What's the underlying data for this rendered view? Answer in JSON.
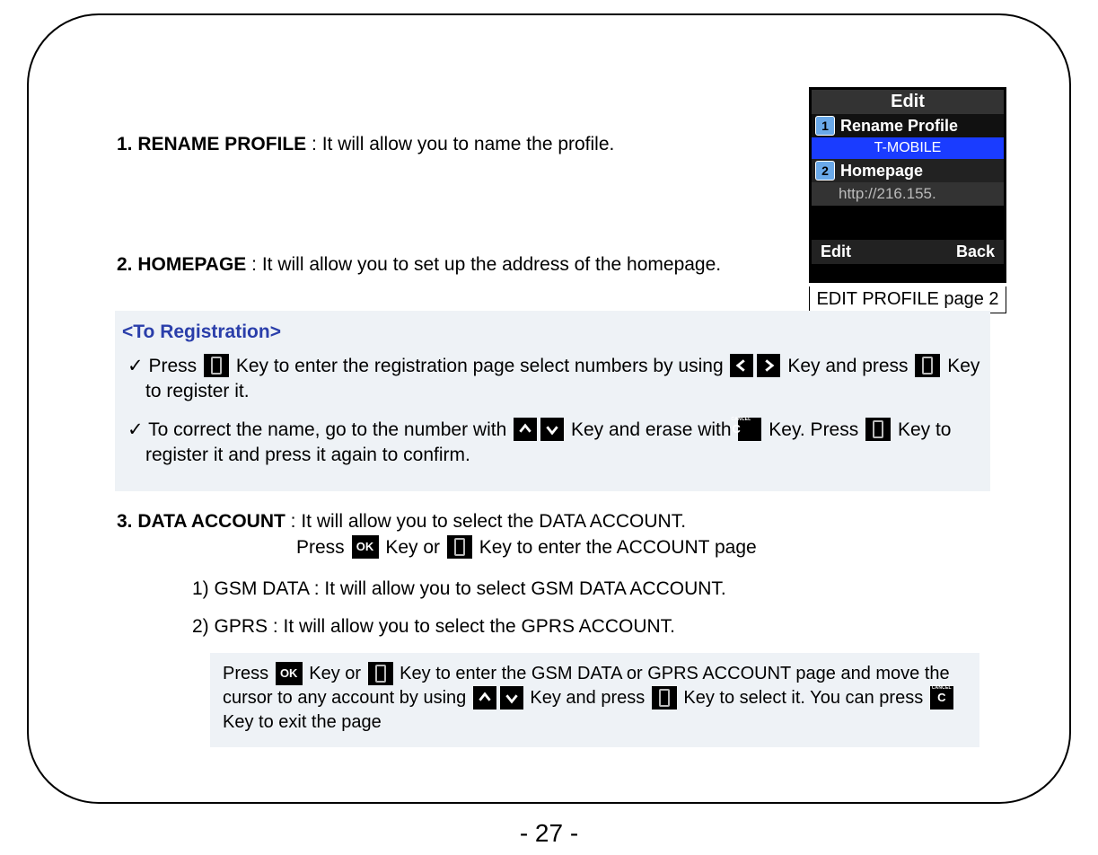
{
  "page_number": "- 27 -",
  "figure": {
    "title": "Edit",
    "item1_num": "1",
    "item1_label": "Rename Profile",
    "selected_value": "T-MOBILE",
    "item2_num": "2",
    "item2_label": "Homepage",
    "url_value": "http://216.155.",
    "softkey_left": "Edit",
    "softkey_right": "Back",
    "caption": "EDIT PROFILE page 2"
  },
  "sections": {
    "s1_heading": "1. RENAME PROFILE",
    "s1_text": " : It will allow you to name the profile.",
    "s2_heading": "2. HOMEPAGE",
    "s2_text": " : It will allow you to set up the address of the homepage.",
    "reg_title": "<To Registration>",
    "reg1_a": "Press",
    "reg1_b": "Key to enter the registration page  select numbers by using",
    "reg1_c": "Key and press",
    "reg1_d": "Key to register it.",
    "reg2_a": "To correct the name, go to the number with",
    "reg2_b": " Key and erase with",
    "reg2_c": "Key. Press",
    "reg2_d": "Key to register it and press it again to confirm.",
    "s3_heading": "3. DATA ACCOUNT",
    "s3_text": " : It will allow you to select the DATA ACCOUNT.",
    "s3_sub_a": "Press ",
    "s3_sub_b": "Key or ",
    "s3_sub_c": " Key to enter the ACCOUNT page",
    "sub1": "1) GSM DATA : It will allow you to select GSM DATA ACCOUNT.",
    "sub2": "2) GPRS : It will allow you to select the GPRS ACCOUNT.",
    "note_a": "Press",
    "note_b": " Key or ",
    "note_c": " Key to enter the GSM DATA or GPRS ACCOUNT page and move the cursor to any  account by using ",
    "note_d": "Key and press ",
    "note_e": " Key to select it. You can press",
    "note_f": " Key to exit the page"
  },
  "keys": {
    "ok": "OK",
    "cancel": "C",
    "cancel_label": "CANCEL"
  }
}
